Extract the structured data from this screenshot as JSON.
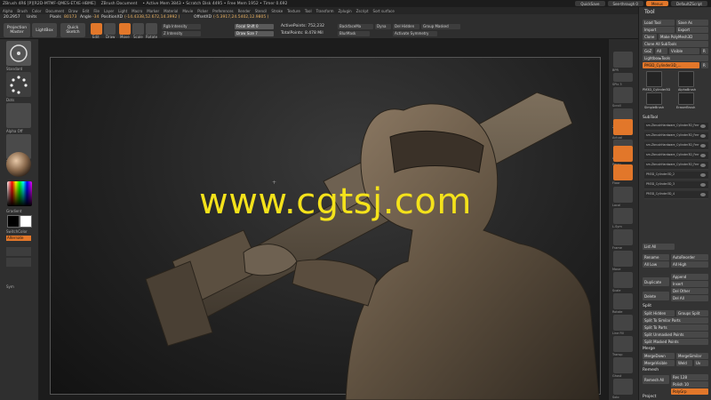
{
  "title_bar": {
    "left": [
      "ZBrush 4R6 [P][R2D-MTMF-QMES-ETXE-HBME]",
      "ZBrush Document",
      "• Active Mem 3843 • Scratch Disk 4495 • Free Mem 1952 • Timer 0.692"
    ],
    "quicksave": "QuickSave",
    "see_through": "See-through 0",
    "menus": "Menus",
    "default_script": "DefaultZScript"
  },
  "menu_bar": {
    "items": [
      "Alpha",
      "Brush",
      "Color",
      "Document",
      "Draw",
      "Edit",
      "File",
      "Layer",
      "Light",
      "Macro",
      "Marker",
      "Material",
      "Movie",
      "Picker",
      "Preferences",
      "Render",
      "Stencil",
      "Stroke",
      "Texture",
      "Tool",
      "Transform",
      "Zplugin",
      "Zscript",
      "Sort surface"
    ]
  },
  "toolbar": {
    "zoom_value": "20.2957",
    "zoom_units": "Units",
    "pixols_label": "Pixols",
    "pixols_value": "80173",
    "angle_label": "Angle",
    "angle_value": "-34",
    "position_label": "PositionXD",
    "position_value": "(-14.4338,52.672,14.3992 )",
    "offset_label": "OffsetXD",
    "offset_value": "(-5.3917,24.5402,12.9805 )",
    "projection_master": "Projection Master",
    "lightbox": "LightBox",
    "quick_sketch": "Quick Sketch",
    "edit": "Edit",
    "draw": "Draw",
    "move": "Move",
    "scale": "Scale",
    "rotate": "Rotate",
    "focal_shift": "Focal Shift 0",
    "draw_size": "Draw Size 7",
    "active_points": "ActivePoints: 752,232",
    "total_points": "TotalPoints: 8.478 Mil",
    "backface": "BackfaceMa",
    "dyna": "Dyna",
    "dynamic": "Dynamic",
    "del_hidden": "Del Hidden",
    "group_masked": "Group Masked",
    "blur_mask": "BlurMask",
    "activate_symmetry": "Activate Symmetry",
    "rgb_intensity": "Rgb Intensity",
    "z_intensity": "Z Intensity"
  },
  "left_shelf": {
    "standard_label": "Standard",
    "dots_label": "Dots",
    "alpha_off": "Alpha Off",
    "texture_off": "Texture Off",
    "material_label": "MatCap",
    "gradient_label": "Gradient",
    "switch_color": "SwitchColor",
    "alternate": "Alternate",
    "sym_label": "Sym"
  },
  "canvas": {
    "watermark": "www.cgtsj.com"
  },
  "right_shelf": {
    "labels": [
      "BPR",
      "SPix 3",
      "Scroll",
      "Zoom",
      "Actual",
      "AAHalf",
      "Persp",
      "Floor",
      "Local",
      "L.Sym",
      "Frame",
      "Move",
      "Scale",
      "Rotate",
      "Line Fill",
      "Transp",
      "Ghost",
      "Solo",
      "Xpose"
    ]
  },
  "tool_palette": {
    "title": "Tool",
    "load_tool": "Load Tool",
    "save_as": "Save As",
    "import": "Import",
    "export": "Export",
    "clone": "Clone",
    "make_polymesh": "Make PolyMesh3D",
    "clone_all_subtools": "Clone All SubTools",
    "goz": "GoZ",
    "all": "All",
    "visible": "Visible",
    "r": "R",
    "lightbox_tools": "Lightbox▸Tools",
    "current_tool": "PM3D_Cylinder3D_...",
    "r_label": "R",
    "thumb_labels": [
      "PM3D_Cylinder3D",
      "AlphaBrush",
      "SimpleBrush",
      "EraserBrush"
    ],
    "subtool_header": "SubTool",
    "subtools": [
      "sm-ZbrushHardware_Cylinder3D_Ferr",
      "sm-ZbrushHardware_Cylinder3D_Ferr",
      "sm-ZbrushHardware_Cylinder3D_Ferr",
      "sm-ZbrushHardware_Cylinder3D_Ferr",
      "sm-ZbrushHardware_Cylinder3D_Ferr",
      "PM3D_Cylinder3D_2",
      "PM3D_Cylinder3D_3",
      "PM3D_Cylinder3D_4"
    ],
    "list_all": "List All",
    "rename": "Rename",
    "auto_reorder": "AutoReorder",
    "all_low": "All Low",
    "all_high": "All High",
    "append": "Append",
    "duplicate": "Duplicate",
    "insert": "Insert",
    "delete": "Delete",
    "del_other": "Del Other",
    "del_all": "Del All",
    "split_header": "Split",
    "split_hidden": "Split Hidden",
    "groups_split": "Groups Split",
    "split_similar": "Split To Similar Parts",
    "split_parts": "Split To Parts",
    "split_unmasked": "Split Unmasked Points",
    "split_masked": "Split Masked Points",
    "merge_header": "Merge",
    "merge_down": "MergeDown",
    "merge_similar": "MergeSimilar",
    "merge_visible": "MergeVisible",
    "weld": "Weld",
    "uv": "Uv",
    "remesh_header": "Remesh",
    "remesh_all": "Remesh All",
    "res": "Res 128",
    "polish": "Polish 10",
    "polygrp": "PolyGrp",
    "project": "Project"
  },
  "colors": {
    "accent": "#e2772a",
    "watermark": "#f4e21b",
    "panel": "#333333",
    "canvas": "#1c1c1c"
  }
}
